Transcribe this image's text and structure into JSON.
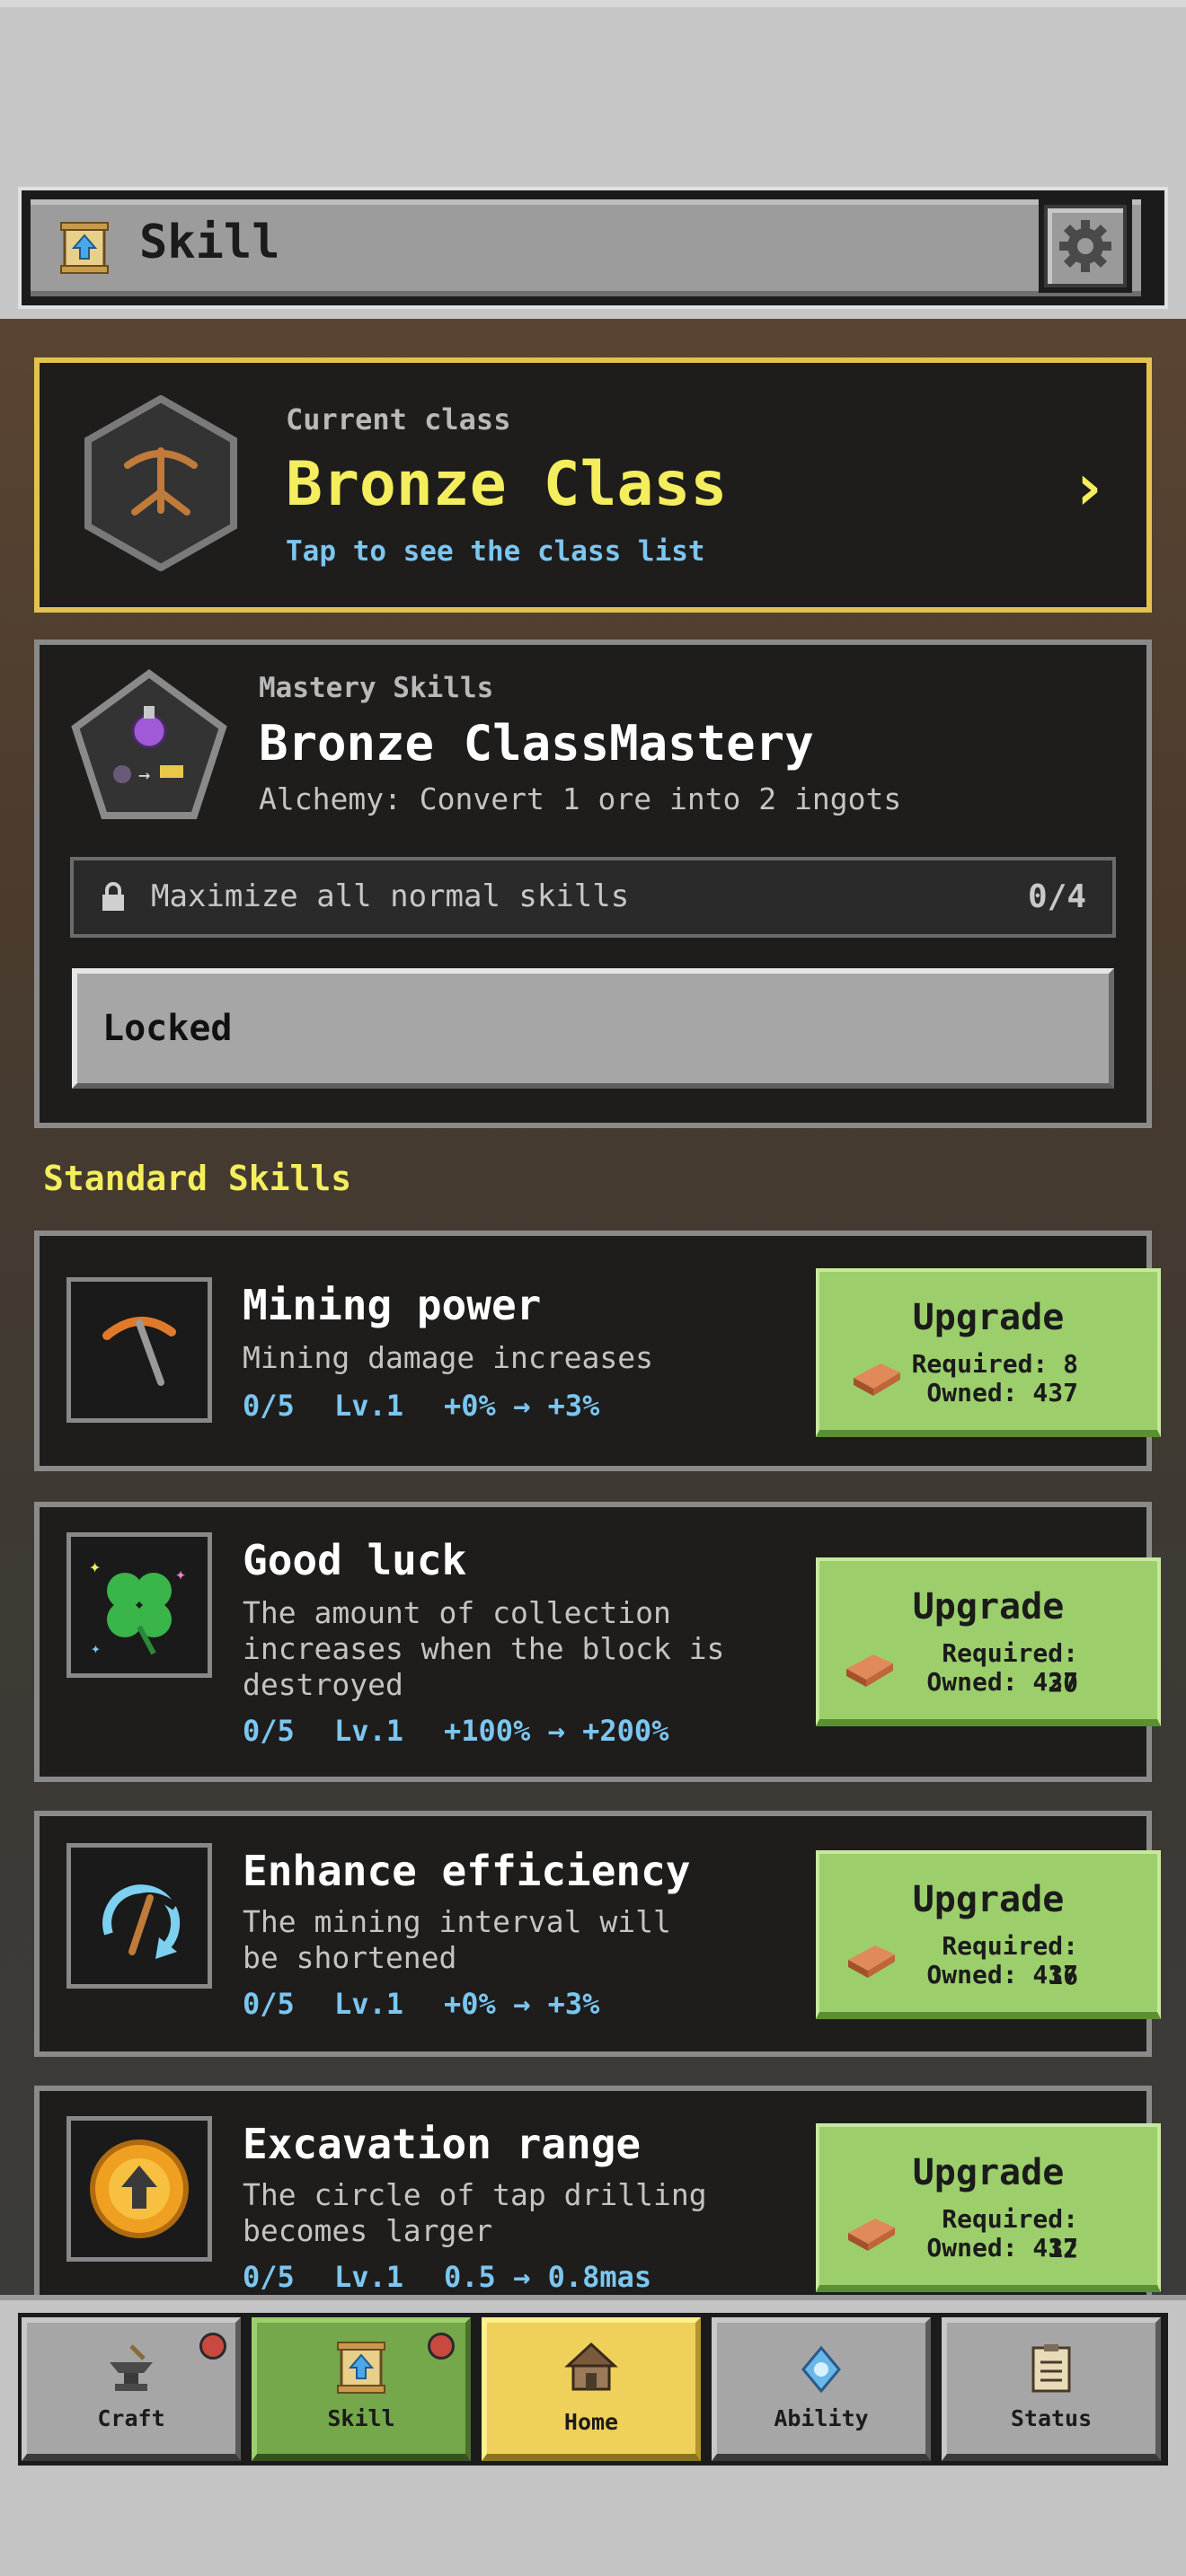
{
  "header": {
    "title": "Skill",
    "scroll_icon": "scroll-upgrade-icon",
    "settings_icon": "gear-icon"
  },
  "current_class": {
    "label": "Current class",
    "name": "Bronze Class",
    "hint": "Tap to see the class list",
    "icon": "pickaxe-emblem-icon"
  },
  "mastery": {
    "label": "Mastery Skills",
    "name": "Bronze ClassMastery",
    "description": "Alchemy: Convert 1 ore into 2 ingots",
    "requirement": "Maximize all normal skills",
    "requirement_count": "0/4",
    "button": "Locked"
  },
  "section_title": "Standard Skills",
  "skills": [
    {
      "name": "Mining power",
      "description": [
        "Mining damage increases"
      ],
      "progress": "0/5",
      "level": "Lv.1",
      "effect": "+0% → +3%",
      "button": "Upgrade",
      "required": "Required: 8",
      "owned": "Owned: 437",
      "icon": "pickaxe-icon"
    },
    {
      "name": "Good luck",
      "description": [
        "The amount of collection",
        "increases when the block is",
        "destroyed"
      ],
      "progress": "0/5",
      "level": "Lv.1",
      "effect": "+100% → +200%",
      "button": "Upgrade",
      "required": "Required: 20",
      "owned": "Owned: 437",
      "icon": "four-leaf-clover-icon"
    },
    {
      "name": "Enhance efficiency",
      "description": [
        "The mining interval will",
        "be shortened"
      ],
      "progress": "0/5",
      "level": "Lv.1",
      "effect": "+0% → +3%",
      "button": "Upgrade",
      "required": "Required: 16",
      "owned": "Owned: 437",
      "icon": "pickaxe-speed-icon"
    },
    {
      "name": "Excavation range",
      "description": [
        "The circle of tap drilling",
        "becomes larger"
      ],
      "progress": "0/5",
      "level": "Lv.1",
      "effect": "0.5 → 0.8mas",
      "button": "Upgrade",
      "required": "Required: 12",
      "owned": "Owned: 437",
      "icon": "range-up-coin-icon"
    }
  ],
  "nav": [
    {
      "label": "Craft",
      "icon": "anvil-icon",
      "badge": true,
      "state": "normal"
    },
    {
      "label": "Skill",
      "icon": "scroll-upgrade-icon",
      "badge": true,
      "state": "selected"
    },
    {
      "label": "Home",
      "icon": "house-icon",
      "badge": false,
      "state": "highlight"
    },
    {
      "label": "Ability",
      "icon": "crystal-icon",
      "badge": false,
      "state": "normal"
    },
    {
      "label": "Status",
      "icon": "clipboard-icon",
      "badge": false,
      "state": "normal"
    }
  ],
  "colors": {
    "accent_yellow": "#f4ee5e",
    "info_blue": "#7cc6f0",
    "upgrade_green": "#9ccf6c",
    "badge_red": "#c9483f"
  }
}
